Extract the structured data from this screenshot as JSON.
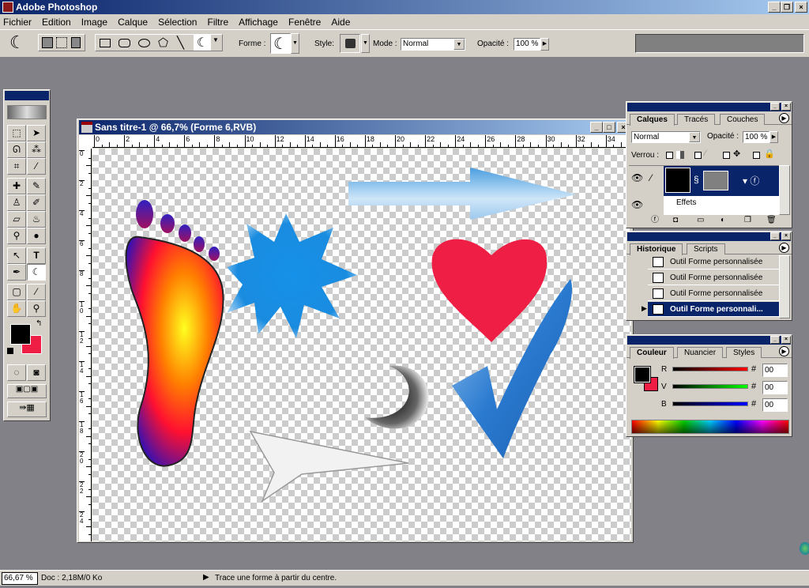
{
  "app": {
    "title": "Adobe Photoshop"
  },
  "menu": [
    "Fichier",
    "Edition",
    "Image",
    "Calque",
    "Sélection",
    "Filtre",
    "Affichage",
    "Fenêtre",
    "Aide"
  ],
  "options": {
    "forme_label": "Forme :",
    "style_label": "Style:",
    "mode_label": "Mode :",
    "mode_value": "Normal",
    "opacity_label": "Opacité :",
    "opacity_value": "100 %",
    "shape_tools": [
      "rectangle-icon",
      "rounded-rectangle-icon",
      "ellipse-icon",
      "polygon-icon",
      "line-icon",
      "custom-shape-icon"
    ]
  },
  "document": {
    "title": "Sans titre-1 @ 66,7% (Forme 6,RVB)",
    "ruler_h": [
      "0",
      "2",
      "4",
      "6",
      "8",
      "10",
      "12",
      "14",
      "16",
      "18",
      "20",
      "22",
      "24",
      "26",
      "28",
      "30",
      "32",
      "34"
    ],
    "ruler_v": [
      "0",
      "2",
      "4",
      "6",
      "8",
      "10",
      "12",
      "14",
      "16",
      "18",
      "20",
      "22",
      "24"
    ]
  },
  "layers_panel": {
    "tabs": [
      "Calques",
      "Tracés",
      "Couches"
    ],
    "blend_mode": "Normal",
    "opacity_label": "Opacité :",
    "opacity_value": "100 %",
    "lock_label": "Verrou :",
    "effects_label": "Effets"
  },
  "history_panel": {
    "tabs": [
      "Historique",
      "Scripts"
    ],
    "items": [
      "Outil Forme personnalisée",
      "Outil Forme personnalisée",
      "Outil Forme personnalisée",
      "Outil Forme personnali..."
    ],
    "selected_index": 3
  },
  "color_panel": {
    "tabs": [
      "Couleur",
      "Nuancier",
      "Styles"
    ],
    "channels": [
      {
        "label": "R",
        "value": "00"
      },
      {
        "label": "V",
        "value": "00"
      },
      {
        "label": "B",
        "value": "00"
      }
    ],
    "foreground": "#000000",
    "background": "#ee1e44"
  },
  "status": {
    "zoom": "66,67 %",
    "doc": "Doc : 2,18M/0 Ko",
    "hint": "Trace une forme à partir du centre."
  }
}
